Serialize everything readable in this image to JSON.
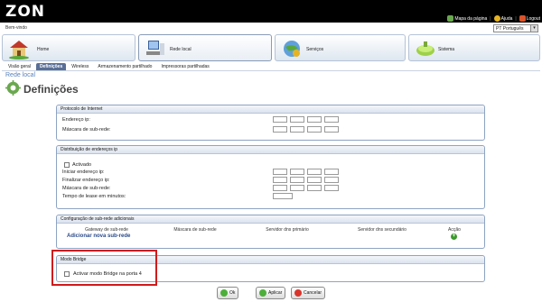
{
  "header": {
    "logo": "ZON",
    "links": [
      {
        "label": "Mapa da página",
        "icon": "map-icon"
      },
      {
        "label": "Ajuda",
        "icon": "help-icon"
      },
      {
        "label": "Logout",
        "icon": "logout-icon"
      }
    ],
    "welcome": "Bem-vindo",
    "language": "PT Português"
  },
  "nav": {
    "tabs": [
      {
        "label": "Home",
        "icon": "house-icon"
      },
      {
        "label": "Rede local",
        "icon": "computer-network-icon"
      },
      {
        "label": "Serviços",
        "icon": "globe-services-icon"
      },
      {
        "label": "Sistema",
        "icon": "gear-system-icon"
      }
    ],
    "active_tab": "Rede local",
    "subtabs": [
      "Visão geral",
      "Definições",
      "Wireless",
      "Armazenamento partilhado",
      "Impressoras partilhadas"
    ],
    "active_subtab": "Definições"
  },
  "page": {
    "breadcrumb": "Rede local",
    "title": "Definições"
  },
  "sections": {
    "internet": {
      "title": "Protocolo de Internet",
      "ip_label": "Endereço ip:",
      "mask_label": "Máscara de sub-rede:"
    },
    "dhcp": {
      "title": "Distribuição de endereços ip",
      "enabled_label": "Activado",
      "start_label": "Iniciar endereço ip:",
      "end_label": "Finalizar endereço ip:",
      "mask_label": "Máscara de sub-rede:",
      "lease_label": "Tempo de lease em minutos:"
    },
    "subnets": {
      "title": "Configuração de sub-rede adicionais",
      "columns": [
        "Gateway de sub-rede",
        "Máscara de sub-rede",
        "Servidor dns primário",
        "Servidor dns secundário",
        "Acção"
      ],
      "add_link": "Adicionar nova sub-rede"
    },
    "bridge": {
      "title": "Modo Bridge",
      "checkbox_label": "Activar modo Bridge na porta 4"
    }
  },
  "actions": {
    "ok": "Ok",
    "apply": "Aplicar",
    "cancel": "Cancelar"
  },
  "colors": {
    "highlight_border": "#d01a1a",
    "active_subtab": "#5a6f96",
    "link": "#2a4a8a"
  }
}
